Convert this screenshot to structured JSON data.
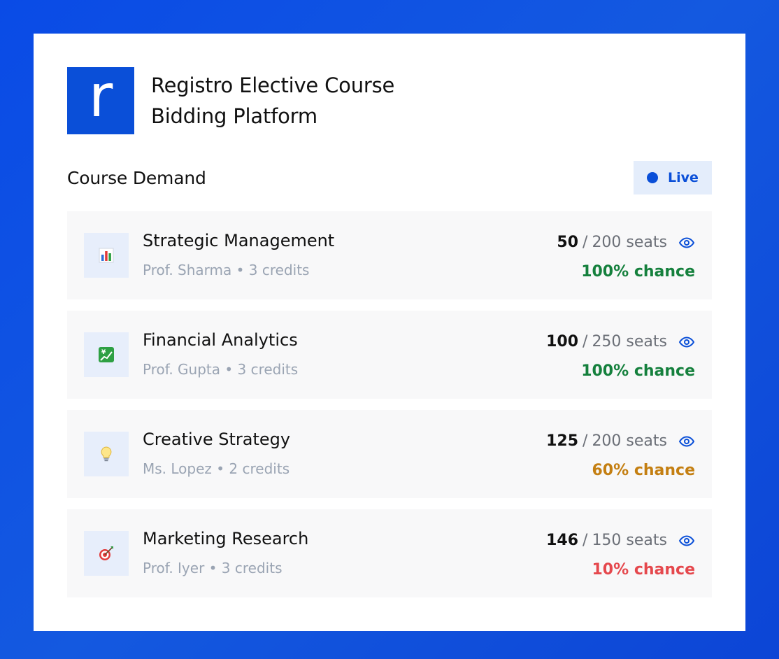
{
  "brand": {
    "logo_letter": "r",
    "title": "Registro Elective Course Bidding Platform"
  },
  "section": {
    "title": "Course Demand",
    "live_label": "Live"
  },
  "courses": [
    {
      "name": "Strategic Management",
      "meta": "Prof. Sharma • 3 credits",
      "bids": "50",
      "separator": "/",
      "capacity": "200 seats",
      "chance": "100% chance",
      "chance_color": "#15803d",
      "icon": "bar-chart-icon"
    },
    {
      "name": "Financial Analytics",
      "meta": "Prof. Gupta • 3 credits",
      "bids": "100",
      "separator": "/",
      "capacity": "250 seats",
      "chance": "100% chance",
      "chance_color": "#15803d",
      "icon": "yen-chart-icon"
    },
    {
      "name": "Creative Strategy",
      "meta": "Ms. Lopez • 2 credits",
      "bids": "125",
      "separator": "/",
      "capacity": "200 seats",
      "chance": "60% chance",
      "chance_color": "#c47f12",
      "icon": "lightbulb-icon"
    },
    {
      "name": "Marketing Research",
      "meta": "Prof. Iyer • 3 credits",
      "bids": "146",
      "separator": "/",
      "capacity": "150 seats",
      "chance": "10% chance",
      "chance_color": "#e5484d",
      "icon": "target-icon"
    }
  ],
  "colors": {
    "accent": "#0a4fd8",
    "live_bg": "#e4edfb",
    "row_bg": "#f8f8f9"
  }
}
